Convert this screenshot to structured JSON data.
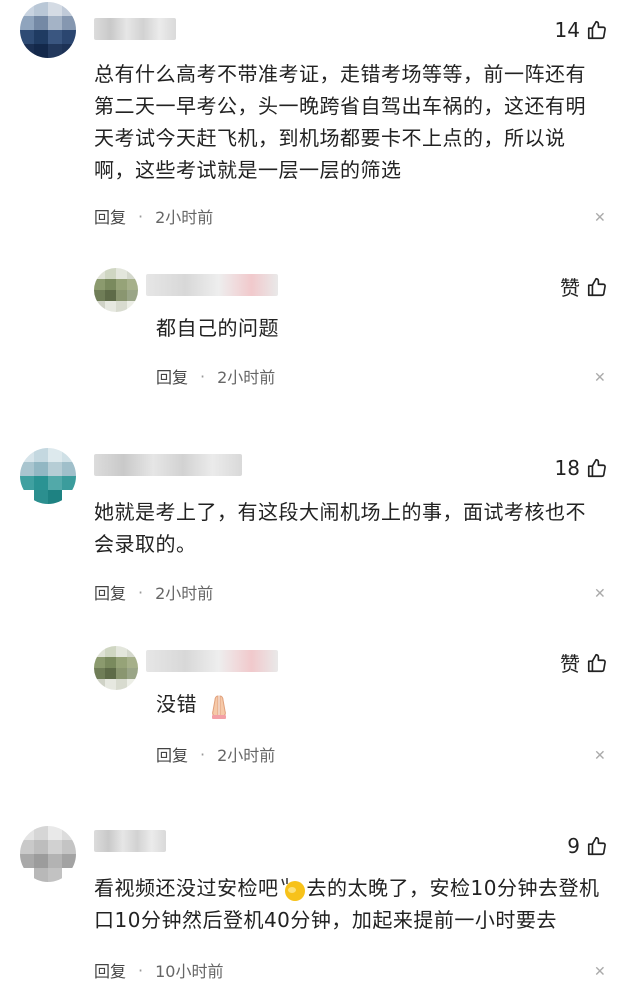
{
  "comments": [
    {
      "likes": "14",
      "text": "总有什么高考不带准考证，走错考场等等，前一阵还有第二天一早考公，头一晚跨省自驾出车祸的，这还有明天考试今天赶飞机，到机场都要卡不上点的，所以说啊，这些考试就是一层一层的筛选",
      "reply_label": "回复",
      "time": "2小时前"
    },
    {
      "likes": "赞",
      "text": "都自己的问题",
      "reply_label": "回复",
      "time": "2小时前"
    },
    {
      "likes": "18",
      "text": "她就是考上了，有这段大闹机场上的事，面试考核也不会录取的。",
      "reply_label": "回复",
      "time": "2小时前"
    },
    {
      "likes": "赞",
      "text": "没错",
      "reply_label": "回复",
      "time": "2小时前"
    },
    {
      "likes": "9",
      "text_a": "看视频还没过安检吧",
      "text_b": "去的太晚了，安检10分钟去登机口10分钟然后登机40分钟，加起来提前一小时要去",
      "reply_label": "回复",
      "time": "10小时前"
    }
  ],
  "icons": {
    "like": "thumbs-up-icon",
    "close": "close-icon"
  },
  "colors": {
    "text": "#222222",
    "meta": "#666666"
  }
}
